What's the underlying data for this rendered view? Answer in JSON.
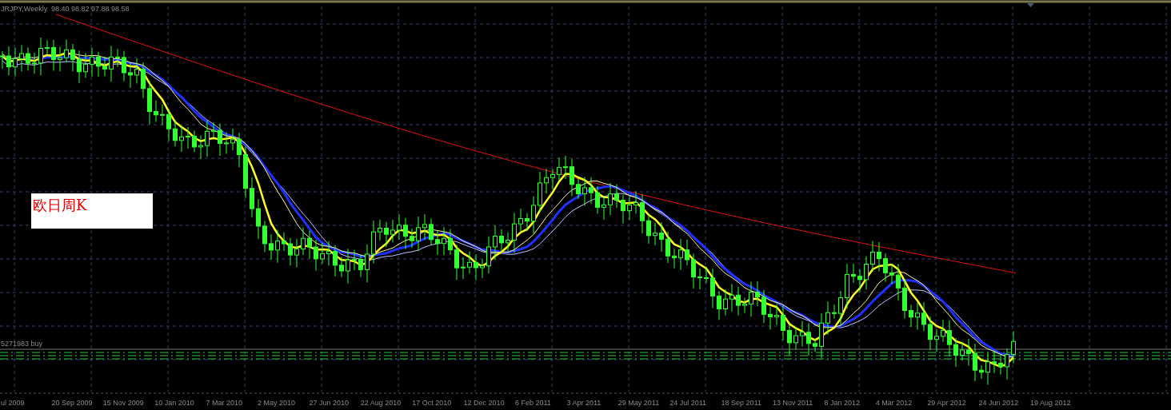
{
  "chart": {
    "title": "JRJPY,Weekly",
    "ohlc": "98.40 98.82 97.88 98.58",
    "order_label": "5271983 buy",
    "note": "欧日周K",
    "x_labels": [
      "ul 2009",
      "20 Sep 2009",
      "15 Nov 2009",
      "10 Jan 2010",
      "7 Mar 2010",
      "2 May 2010",
      "27 Jun 2010",
      "22 Aug 2010",
      "17 Oct 2010",
      "12 Dec 2010",
      "6 Feb 2011",
      "3 Apr 2011",
      "29 May 2011",
      "24 Jul 2011",
      "18 Sep 2011",
      "13 Nov 2011",
      "8 Jan 2012",
      "4 Mar 2012",
      "29 Apr 2012",
      "24 Jun 2012",
      "19 Aug 2012"
    ]
  }
}
